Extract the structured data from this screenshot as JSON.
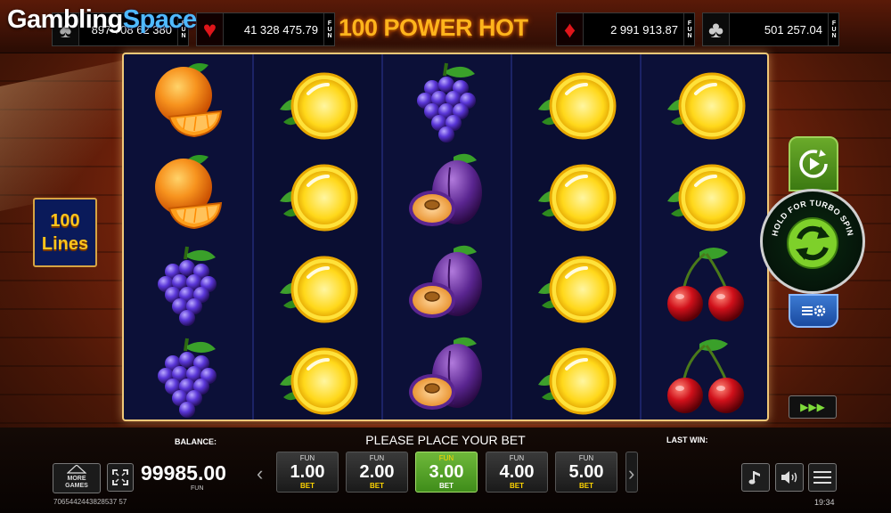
{
  "logo": {
    "word1": "Gambling",
    "word2": "Space"
  },
  "game_title": "100 POWER HOT",
  "jackpots": [
    {
      "suit": "spade-icon",
      "glyph": "♠",
      "value": "897 708 62 380",
      "fun_label": "FUN"
    },
    {
      "suit": "heart-icon",
      "glyph": "♥",
      "value": "41 328 475.79",
      "fun_label": "FUN"
    },
    {
      "suit": "diamond-icon",
      "glyph": "♦",
      "value": "2 991 913.87",
      "fun_label": "FUN"
    },
    {
      "suit": "club-icon",
      "glyph": "♣",
      "value": "501 257.04",
      "fun_label": "FUN"
    }
  ],
  "lines_badge": {
    "count": "100",
    "label": "Lines"
  },
  "reels": [
    [
      "orange",
      "orange",
      "grapes",
      "grapes"
    ],
    [
      "lemon",
      "lemon",
      "lemon",
      "lemon"
    ],
    [
      "grapes",
      "plum",
      "plum",
      "plum"
    ],
    [
      "lemon",
      "lemon",
      "lemon",
      "lemon"
    ],
    [
      "lemon",
      "lemon",
      "cherries",
      "cherries"
    ]
  ],
  "controls": {
    "autoplay_icon": "autoplay-icon",
    "spin_hint": "HOLD FOR TURBO SPIN",
    "settings_icon": "settings-icon",
    "fast_play_icon": "fast-forward-icon"
  },
  "bottom": {
    "balance_label": "BALANCE:",
    "balance_value": "99985.00",
    "balance_currency": "FUN",
    "status_message": "PLEASE PLACE YOUR BET",
    "last_win_label": "LAST WIN:",
    "more_games_label_line1": "MORE",
    "more_games_label_line2": "GAMES",
    "prev_arrow": "‹",
    "next_arrow": "›",
    "bets": [
      {
        "fun": "FUN",
        "value": "1.00",
        "bet": "BET",
        "selected": false
      },
      {
        "fun": "FUN",
        "value": "2.00",
        "bet": "BET",
        "selected": false
      },
      {
        "fun": "FUN",
        "value": "3.00",
        "bet": "BET",
        "selected": true
      },
      {
        "fun": "FUN",
        "value": "4.00",
        "bet": "BET",
        "selected": false
      },
      {
        "fun": "FUN",
        "value": "5.00",
        "bet": "BET",
        "selected": false
      }
    ],
    "session_id": "7065442443828537 57",
    "clock": "19:34"
  },
  "colors": {
    "accent_green": "#4f9e20",
    "title_orange": "#ffb41c",
    "logo_blue": "#4fb9ff",
    "reel_bg": "#0c1038"
  }
}
